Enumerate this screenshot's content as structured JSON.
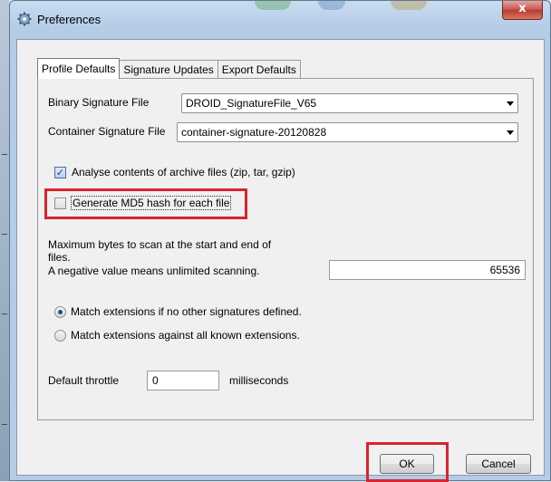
{
  "window": {
    "title": "Preferences",
    "close_label": "x",
    "icon": "gear-icon"
  },
  "tabs": [
    {
      "label": "Profile Defaults",
      "active": true
    },
    {
      "label": "Signature Updates",
      "active": false
    },
    {
      "label": "Export Defaults",
      "active": false
    }
  ],
  "binary_signature": {
    "label": "Binary Signature File",
    "value": "DROID_SignatureFile_V65"
  },
  "container_signature": {
    "label": "Container Signature File",
    "value": "container-signature-20120828"
  },
  "analyse_archives": {
    "label": "Analyse contents of archive files (zip, tar, gzip)",
    "checked": true
  },
  "generate_md5": {
    "label": "Generate MD5 hash for each file",
    "checked": false
  },
  "max_bytes": {
    "label_line1": "Maximum bytes to scan at the start and end of",
    "label_line2": "files.",
    "label_line3": "A negative value means unlimited scanning.",
    "value": "65536"
  },
  "match_options": [
    {
      "label": "Match extensions if no other signatures defined.",
      "selected": true
    },
    {
      "label": "Match extensions against all known extensions.",
      "selected": false
    }
  ],
  "throttle": {
    "label": "Default throttle",
    "value": "0",
    "unit": "milliseconds"
  },
  "buttons": {
    "ok": "OK",
    "cancel": "Cancel"
  },
  "colors": {
    "highlight": "#d9232e",
    "accent": "#1f4e8a"
  }
}
